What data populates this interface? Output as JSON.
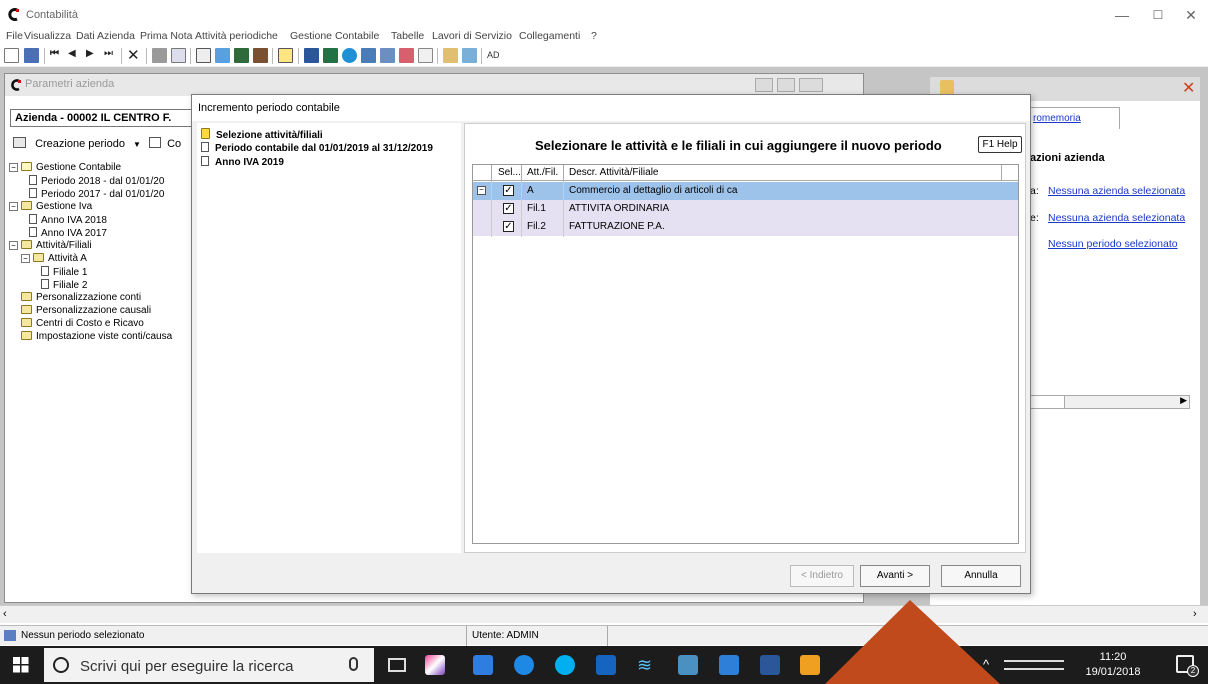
{
  "app": {
    "title": "Contabilità",
    "min": "—",
    "max": "☐",
    "close": "✕"
  },
  "menu": [
    "File",
    "Visualizza",
    "Dati Azienda",
    "Prima Nota",
    "Attività periodiche",
    "Gestione Contabile",
    "Tabelle",
    "Lavori di Servizio",
    "Collegamenti",
    "?"
  ],
  "param_window": {
    "title": "Parametri azienda",
    "azienda": "Azienda - 00002 IL CENTRO F.",
    "creazione": "Creazione periodo",
    "co_label": "Co",
    "tree": [
      {
        "label": "Gestione Contabile",
        "type": "folder",
        "level": 0,
        "toggle": "-"
      },
      {
        "label": "Periodo 2018 - dal 01/01/20",
        "type": "doc",
        "level": 1
      },
      {
        "label": "Periodo 2017 - dal 01/01/20",
        "type": "doc",
        "level": 1
      },
      {
        "label": "Gestione Iva",
        "type": "folder",
        "level": 0,
        "toggle": "-"
      },
      {
        "label": "Anno IVA 2018",
        "type": "doc",
        "level": 1
      },
      {
        "label": "Anno IVA 2017",
        "type": "doc",
        "level": 1
      },
      {
        "label": "Attività/Filiali",
        "type": "folder",
        "level": 0,
        "toggle": "-"
      },
      {
        "label": "Attività A",
        "type": "folder",
        "level": 1,
        "toggle": "-"
      },
      {
        "label": "Filiale 1",
        "type": "doc",
        "level": 2
      },
      {
        "label": "Filiale 2",
        "type": "doc",
        "level": 2
      },
      {
        "label": "Personalizzazione conti",
        "type": "folder",
        "level": 0
      },
      {
        "label": "Personalizzazione causali",
        "type": "folder",
        "level": 0
      },
      {
        "label": "Centri di Costo e Ricavo",
        "type": "folder",
        "level": 0
      },
      {
        "label": "Impostazione viste conti/causa",
        "type": "folder",
        "level": 0
      }
    ]
  },
  "right_panel": {
    "tab": "romemoria",
    "heading": "azioni azienda",
    "prefix1": "a:",
    "link1": "Nessuna azienda selezionata",
    "prefix2": "e:",
    "link2": "Nessuna azienda selezionata",
    "link3": "Nessun periodo selezionato"
  },
  "dialog": {
    "title": "Incremento periodo contabile",
    "steps": [
      {
        "label": "Selezione attività/filiali",
        "active": true
      },
      {
        "label": "Periodo contabile dal 01/01/2019 al 31/12/2019",
        "active": false
      },
      {
        "label": "Anno IVA 2019",
        "active": false
      }
    ],
    "header": "Selezionare le attività e le filiali in cui aggiungere il nuovo periodo",
    "help_button": "F1 Help",
    "columns": [
      "Sel...",
      "Att./Fil.",
      "Descr. Attività/Filiale"
    ],
    "rows": [
      {
        "code": "A",
        "descr": "Commercio al dettaglio di articoli di ca",
        "checked": true,
        "selected": true,
        "group": true
      },
      {
        "code": "Fil.1",
        "descr": "ATTIVITA ORDINARIA",
        "checked": true,
        "selected": false
      },
      {
        "code": "Fil.2",
        "descr": "FATTURAZIONE P.A.",
        "checked": true,
        "selected": false
      }
    ],
    "buttons": {
      "back": "< Indietro",
      "next": "Avanti >",
      "cancel": "Annulla"
    }
  },
  "status": {
    "left": "Nessun periodo selezionato",
    "user": "Utente: ADMIN"
  },
  "taskbar": {
    "search_placeholder": "Scrivi qui per eseguire la ricerca",
    "time": "11:20",
    "date": "19/01/2018",
    "notif_count": "2"
  }
}
